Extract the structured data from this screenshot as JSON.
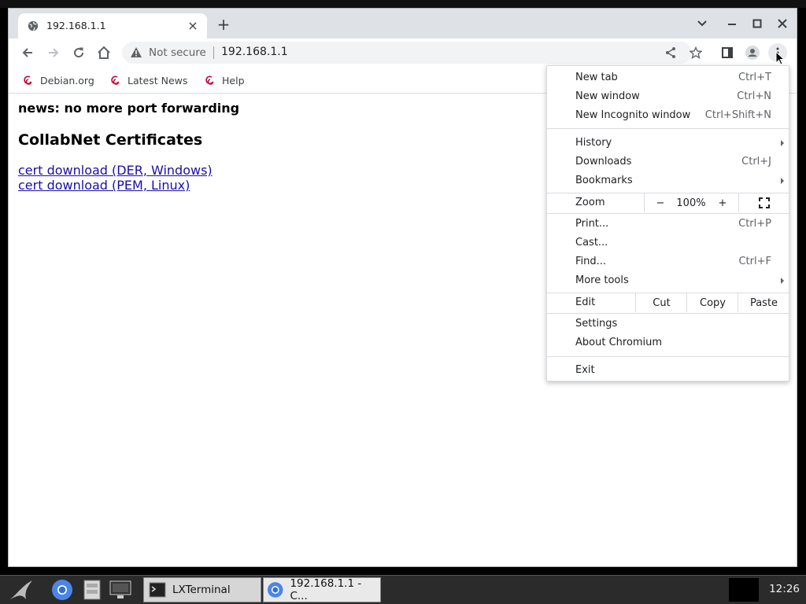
{
  "browser": {
    "tab_title": "192.168.1.1",
    "not_secure": "Not secure",
    "url": "192.168.1.1"
  },
  "bookmarks": [
    {
      "label": "Debian.org",
      "icon": "debian-swirl-icon"
    },
    {
      "label": "Latest News",
      "icon": "debian-swirl-icon"
    },
    {
      "label": "Help",
      "icon": "debian-swirl-icon"
    }
  ],
  "page": {
    "news": "news: no more port forwarding",
    "heading": "CollabNet Certificates",
    "links": [
      "cert download (DER, Windows)",
      "cert download (PEM, Linux)"
    ]
  },
  "menu": {
    "new_tab": {
      "label": "New tab",
      "shortcut": "Ctrl+T"
    },
    "new_window": {
      "label": "New window",
      "shortcut": "Ctrl+N"
    },
    "new_incognito": {
      "label": "New Incognito window",
      "shortcut": "Ctrl+Shift+N"
    },
    "history": {
      "label": "History"
    },
    "downloads": {
      "label": "Downloads",
      "shortcut": "Ctrl+J"
    },
    "bookmarks": {
      "label": "Bookmarks"
    },
    "zoom": {
      "label": "Zoom",
      "minus": "−",
      "value": "100%",
      "plus": "+"
    },
    "print": {
      "label": "Print...",
      "shortcut": "Ctrl+P"
    },
    "cast": {
      "label": "Cast..."
    },
    "find": {
      "label": "Find...",
      "shortcut": "Ctrl+F"
    },
    "more_tools": {
      "label": "More tools"
    },
    "edit": {
      "label": "Edit",
      "cut": "Cut",
      "copy": "Copy",
      "paste": "Paste"
    },
    "settings": {
      "label": "Settings"
    },
    "about": {
      "label": "About Chromium"
    },
    "exit": {
      "label": "Exit"
    }
  },
  "taskbar": {
    "tasks": [
      {
        "label": "LXTerminal"
      },
      {
        "label": "192.168.1.1 - C..."
      }
    ],
    "clock": "12:26"
  },
  "colors": {
    "link": "#1a0dab",
    "tabstrip": "#dee1e6",
    "taskbar": "#2b2b2b"
  }
}
